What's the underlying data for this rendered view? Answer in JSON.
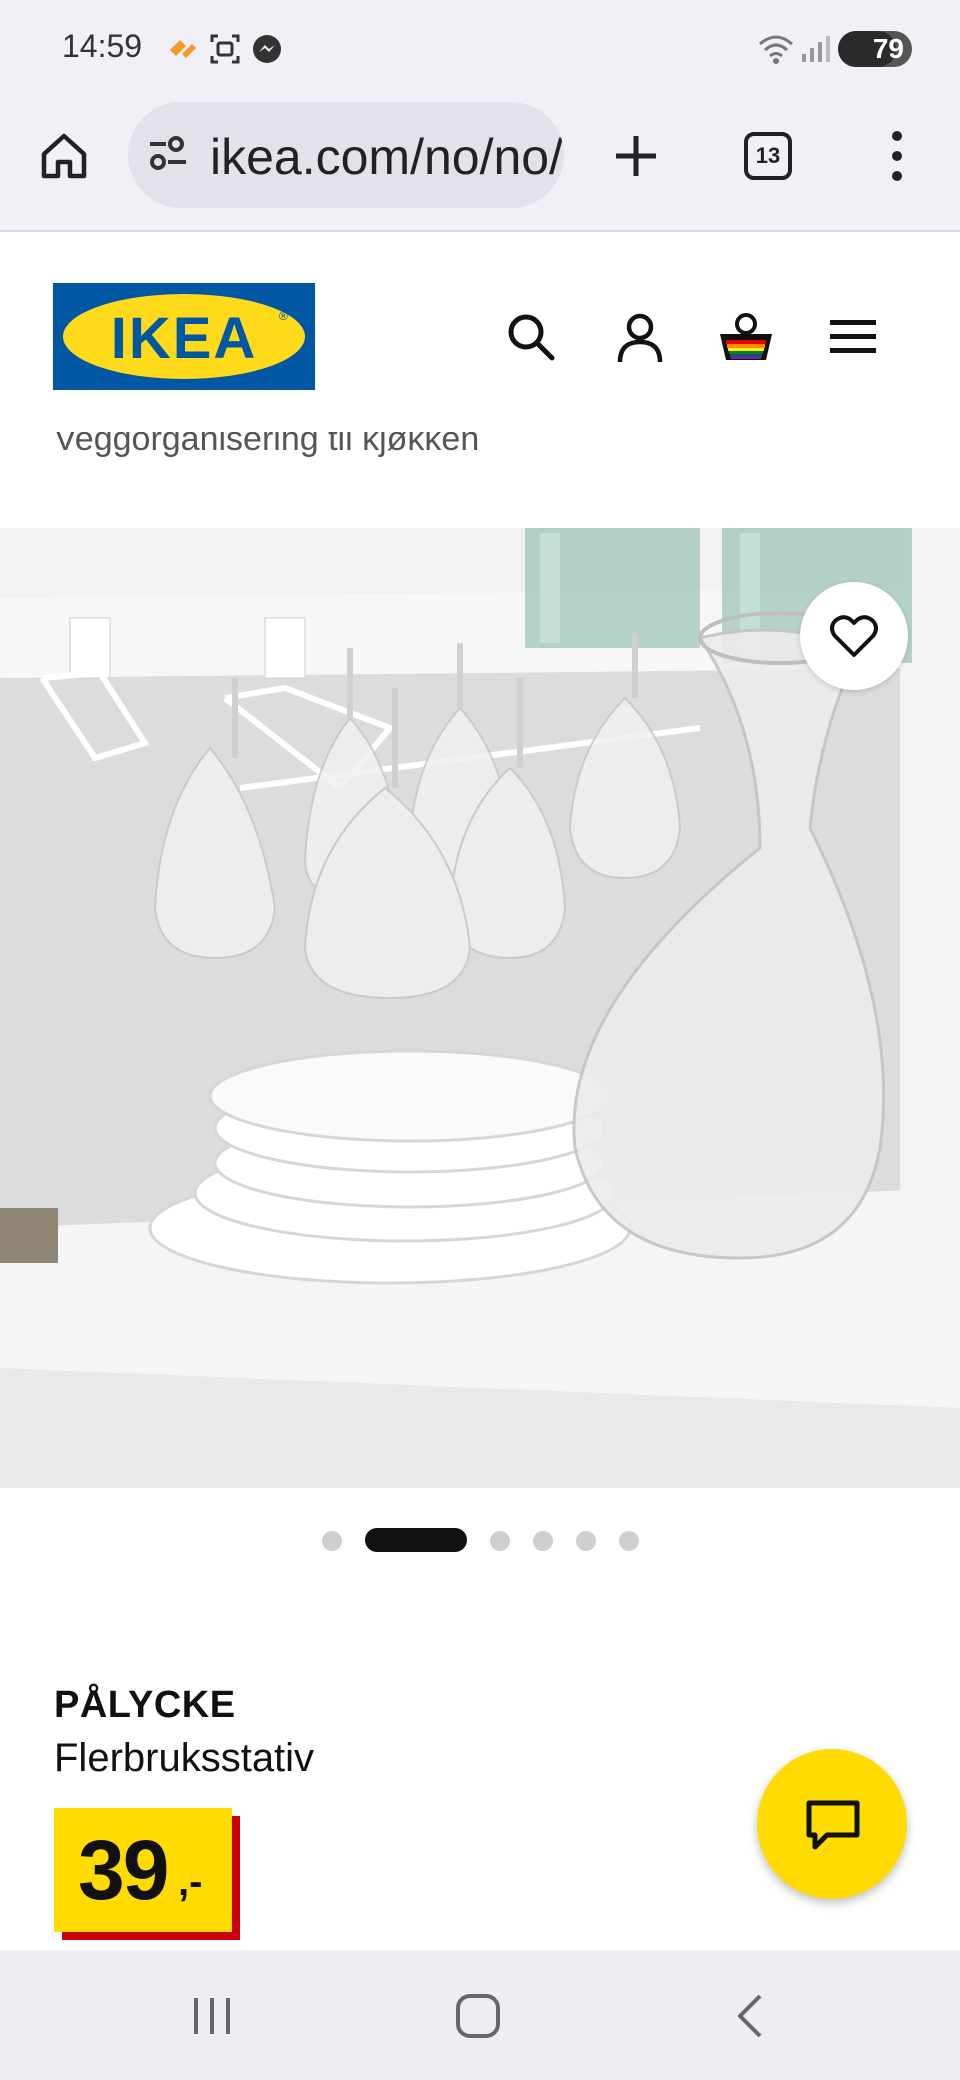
{
  "status_bar": {
    "time": "14:59",
    "battery": "79",
    "battery_level": 0.79
  },
  "browser": {
    "url": "ikea.com/no/no/p/palycke",
    "tab_count": "13"
  },
  "header": {
    "logo_text": "IKEA"
  },
  "breadcrumb": {
    "text": "Veggorganisering til kjøkken"
  },
  "carousel": {
    "count": 6,
    "active_index": 1
  },
  "product": {
    "name": "PÅLYCKE",
    "description": "Flerbruksstativ",
    "price_integer": "39",
    "price_decimal": ",-"
  },
  "colors": {
    "ikea_blue": "#0058a3",
    "ikea_yellow": "#ffdb00",
    "price_red": "#cc0008"
  }
}
